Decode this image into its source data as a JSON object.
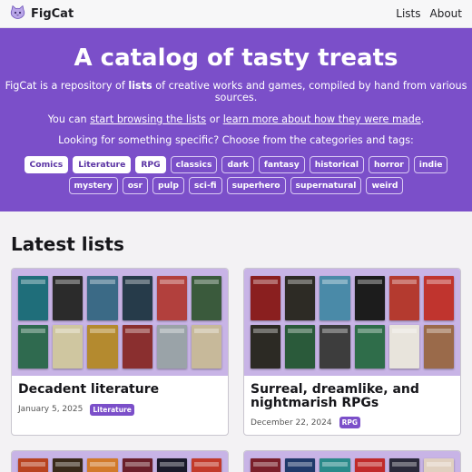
{
  "nav": {
    "brand": "FigCat",
    "links": [
      "Lists",
      "About"
    ]
  },
  "hero": {
    "title": "A catalog of tasty treats",
    "line1": {
      "pre": "FigCat is a repository of ",
      "bold": "lists",
      "post": " of creative works and games, compiled by hand from various sources."
    },
    "line2": {
      "pre": "You can ",
      "link1": "start browsing the lists",
      "mid": " or ",
      "link2": "learn more about how they were made",
      "post": "."
    },
    "line3": "Looking for something specific? Choose from the categories and tags:",
    "categories": [
      "Comics",
      "Literature",
      "RPG"
    ],
    "tags": [
      "classics",
      "dark",
      "fantasy",
      "historical",
      "horror",
      "indie",
      "mystery",
      "osr",
      "pulp",
      "sci-fi",
      "superhero",
      "supernatural",
      "weird"
    ]
  },
  "latest": {
    "heading": "Latest lists",
    "cards": [
      {
        "title": "Decadent literature",
        "date": "January 5, 2025",
        "badge": "Literature",
        "cover_colors": [
          "#1f6e7a",
          "#2b2b2b",
          "#3b6a86",
          "#263b4a",
          "#b2403d",
          "#3a5a3c",
          "#2f6a4f",
          "#cfc6a0",
          "#b48a2f",
          "#8a2f2f",
          "#9aa3a8",
          "#c7b99a"
        ]
      },
      {
        "title": "Surreal, dreamlike, and nightmarish RPGs",
        "date": "December 22, 2024",
        "badge": "RPG",
        "cover_colors": [
          "#8a1f1f",
          "#2d2b25",
          "#4a8aa8",
          "#1c1c1c",
          "#b43a2f",
          "#c0342e",
          "#2c2a24",
          "#2a5a3a",
          "#3d3d3d",
          "#2f6d4a",
          "#e8e4dc",
          "#9a6a4a"
        ]
      }
    ],
    "more_covers": [
      [
        "#b8431f",
        "#3a2a1a",
        "#d27a2a",
        "#6a1f2a",
        "#1a1a2a",
        "#c23a2a"
      ],
      [
        "#7a1f2a",
        "#1f3a6a",
        "#2a8a8a",
        "#c02a2a",
        "#2a2a3a",
        "#e0d0c0"
      ]
    ]
  }
}
